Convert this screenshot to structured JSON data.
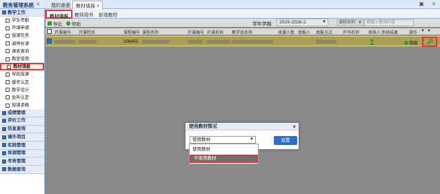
{
  "app": {
    "title": "教务管理系统",
    "collapse": "«"
  },
  "top_tabs": [
    {
      "label": "我的桌面"
    },
    {
      "label": "教材填报 ×"
    }
  ],
  "sidebar": {
    "section": "教学工作",
    "items": [
      {
        "label": "学生考勤"
      },
      {
        "label": "开课申请"
      },
      {
        "label": "授课任务"
      },
      {
        "label": "调停补课"
      },
      {
        "label": "课表查询"
      },
      {
        "label": "教室借用"
      },
      {
        "label": "教材填报"
      },
      {
        "label": "单段授课"
      },
      {
        "label": "缓考认定"
      },
      {
        "label": "教学设计"
      },
      {
        "label": "免听认定"
      },
      {
        "label": "授课资格"
      }
    ],
    "collapsed": [
      {
        "label": "成绩管理"
      },
      {
        "label": "评价工作"
      },
      {
        "label": "信息查询"
      },
      {
        "label": "课外项目"
      },
      {
        "label": "实践管理"
      },
      {
        "label": "体测管理"
      },
      {
        "label": "考务管理"
      },
      {
        "label": "数据查询"
      }
    ]
  },
  "subtabs": [
    {
      "label": "教材填报"
    },
    {
      "label": "教师用书"
    },
    {
      "label": "新增教材"
    }
  ],
  "toolbar": {
    "export": "导出",
    "help": "帮助",
    "term_label": "学年学期:",
    "term_value": "2025-2026-2",
    "search_type": "课程名称",
    "search_placeholder": "请输入查询内容"
  },
  "table": {
    "headers": [
      "开课编号",
      "开课院系",
      "课程编号",
      "课程名称",
      "开课编号",
      "开课名称",
      "教学班名称",
      "排课人数",
      "填报人",
      "填报方式",
      "开书名称",
      "审核人",
      "审核结果",
      "操作"
    ],
    "row": {
      "course_no": "006455",
      "fill_label": "填报"
    }
  },
  "dialog": {
    "title": "使用教材情况",
    "close": "×",
    "select_value": "使用教材",
    "button": "设置",
    "options": [
      "使用教材",
      "不使用教材"
    ]
  }
}
